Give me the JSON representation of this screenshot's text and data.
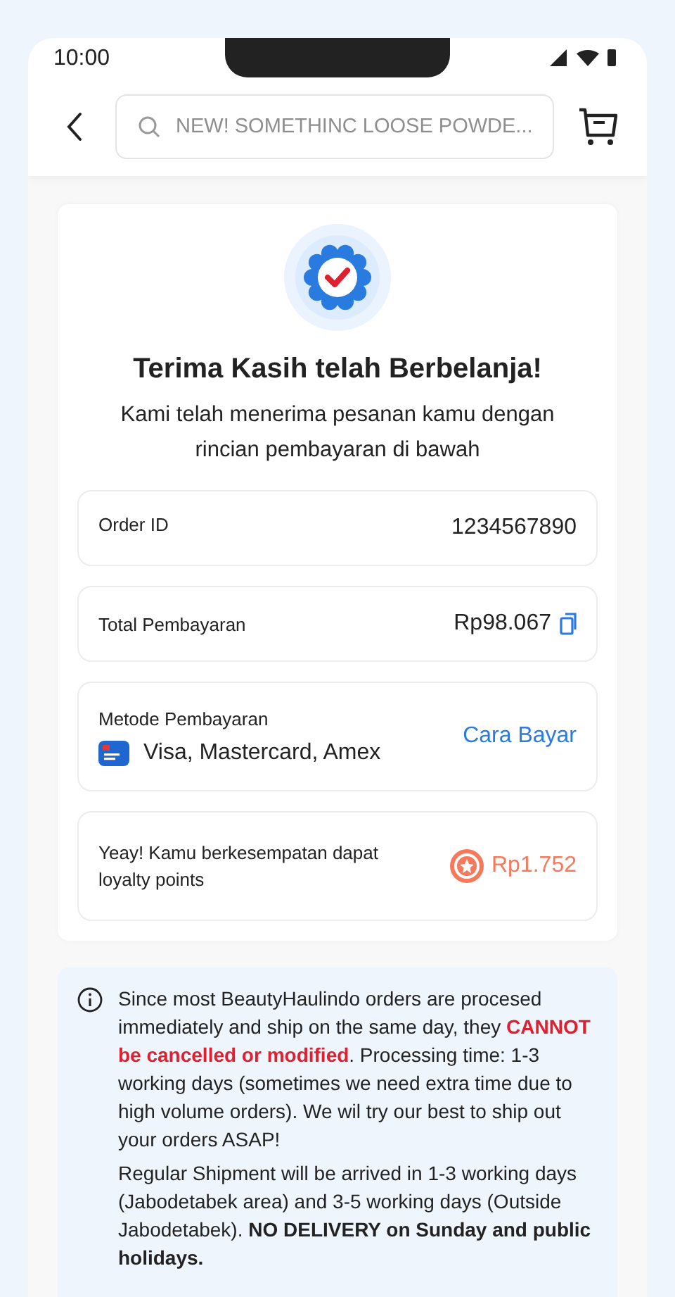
{
  "status_bar": {
    "time": "10:00"
  },
  "header": {
    "search": {
      "placeholder": "NEW! SOMETHINC LOOSE POWDE..."
    }
  },
  "confirmation": {
    "title": "Terima Kasih telah Berbelanja!",
    "message": "Kami telah menerima pesanan kamu dengan rincian pembayaran di bawah"
  },
  "details": [
    {
      "kind": "plain",
      "label": "Order ID",
      "value": "1234567890"
    },
    {
      "kind": "copy",
      "label": "Total Pembayaran",
      "value": "Rp98.067"
    },
    {
      "kind": "method",
      "label": "Metode Pembayaran",
      "value": "Visa, Mastercard, Amex",
      "action": "Cara Bayar"
    },
    {
      "kind": "points",
      "label": "Yeay! Kamu berkesempatan dapat loyalty points",
      "value": "Rp1.752"
    }
  ],
  "notice": [
    {
      "kind": "alert",
      "text": "Since most BeautyHaulindo orders are procesed immediately and ship on the same day, they **CANNOT be cancelled or modified**. Processing time: 1-3 working days (sometimes we need extra time due to high volume orders). We wil try our best to ship out your orders ASAP!"
    },
    {
      "kind": "note",
      "text": "Regular Shipment will be arrived in 1-3 working days (Jabodetabek area) and 3-5 working days (Outside Jabodetabek). **NO DELIVERY on Sunday and public holidays.**"
    }
  ]
}
